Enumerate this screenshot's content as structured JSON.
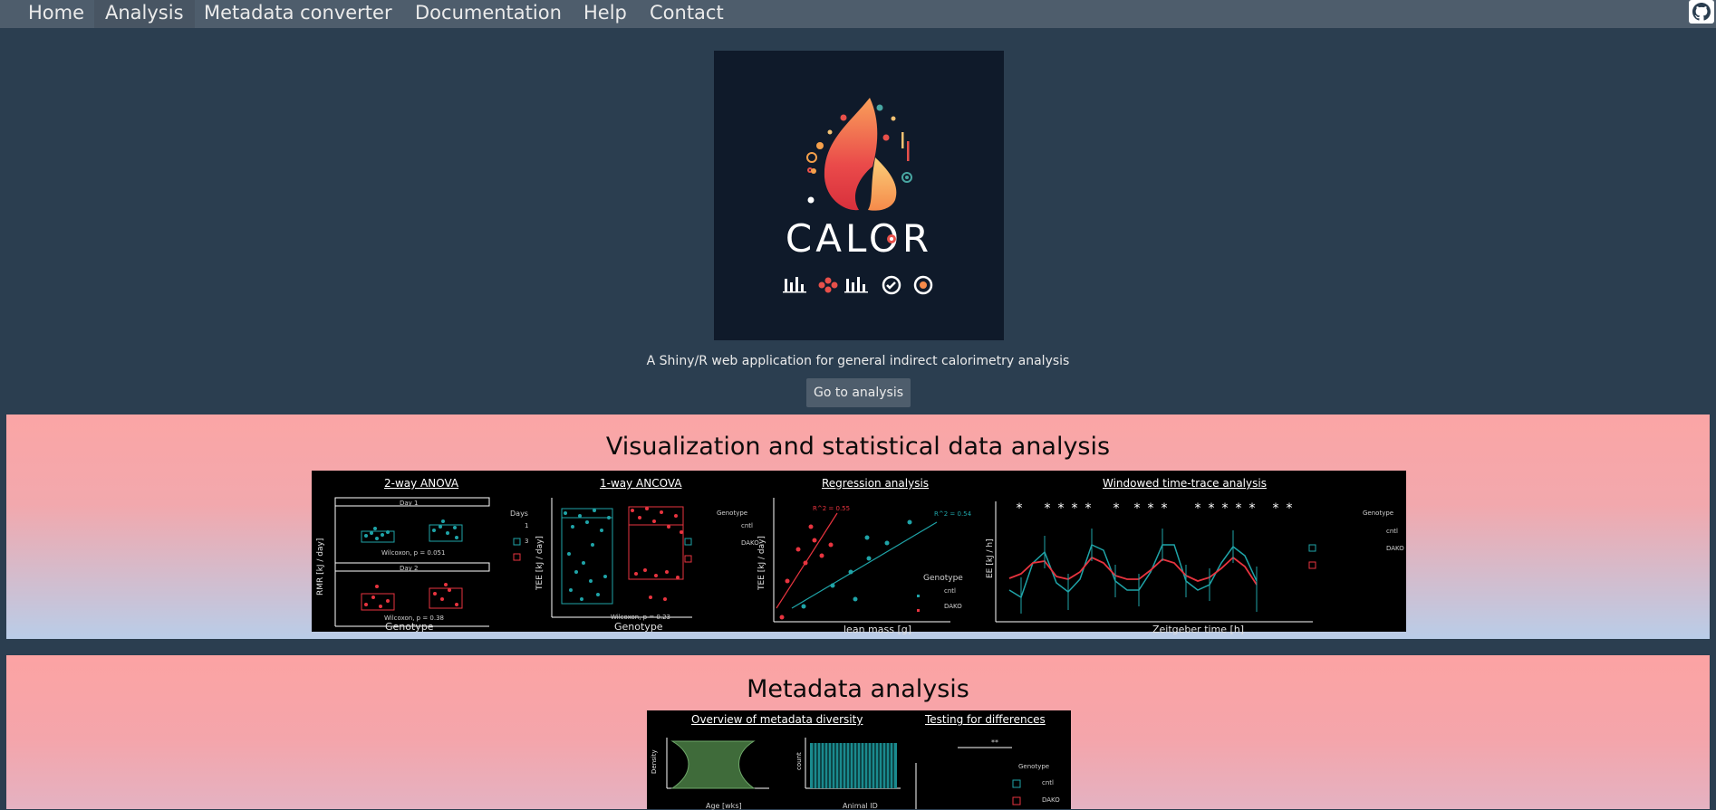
{
  "nav": {
    "items": [
      {
        "label": "Home",
        "active": false
      },
      {
        "label": "Analysis",
        "active": true
      },
      {
        "label": "Metadata converter",
        "active": false
      },
      {
        "label": "Documentation",
        "active": false
      },
      {
        "label": "Help",
        "active": false
      },
      {
        "label": "Contact",
        "active": false
      }
    ],
    "github_icon": "github-icon"
  },
  "hero": {
    "logo_text": "CALOR",
    "tagline": "A Shiny/R web application for general indirect calorimetry analysis",
    "button_label": "Go to analysis"
  },
  "sections": {
    "viz": {
      "title": "Visualization and statistical data analysis",
      "panels": {
        "anova": {
          "title": "2-way ANOVA",
          "ylabel": "RMR [kJ / day]",
          "xlabel": "Genotype",
          "facet1": "Day 1",
          "facet2": "Day 2",
          "stat1": "Wilcoxon, p = 0.051",
          "stat2": "Wilcoxon, p = 0.38",
          "legend_title": "Days",
          "legend_items": [
            "1",
            "3"
          ]
        },
        "ancova": {
          "title": "1-way ANCOVA",
          "ylabel": "TEE [kJ / day]",
          "xlabel": "Genotype",
          "stat": "Wilcoxon, p = 0.23",
          "legend_title": "Genotype",
          "legend_items": [
            "cntl",
            "DAKO"
          ]
        },
        "regression": {
          "title": "Regression analysis",
          "ylabel": "TEE [kJ / day]",
          "xlabel": "lean mass [g]",
          "r2_red": "R^2 = 0.55",
          "r2_teal": "R^2 = 0.54",
          "legend_title": "Genotype",
          "legend_items": [
            "cntl",
            "DAKO"
          ]
        },
        "timetrace": {
          "title": "Windowed time-trace analysis",
          "ylabel": "EE [kJ / h]",
          "xlabel": "Zeitgeber time [h]",
          "legend_title": "Genotype",
          "legend_items": [
            "cntl",
            "DAKO"
          ],
          "significance": "*"
        }
      }
    },
    "meta": {
      "title": "Metadata analysis",
      "panels": {
        "diversity": {
          "title": "Overview of metadata diversity",
          "xlabel_left": "Age [wks]",
          "ylabel_left": "Density",
          "xlabel_right": "Animal ID",
          "ylabel_right": "count"
        },
        "testing": {
          "title": "Testing for differences",
          "significance": "**",
          "legend_title": "Genotype",
          "legend_items": [
            "cntl",
            "DAKO"
          ]
        }
      }
    }
  },
  "colors": {
    "page_bg": "#2b3e50",
    "navbar_bg": "#4e5d6c",
    "teal": "#1fa4a8",
    "red": "#e8343f"
  }
}
